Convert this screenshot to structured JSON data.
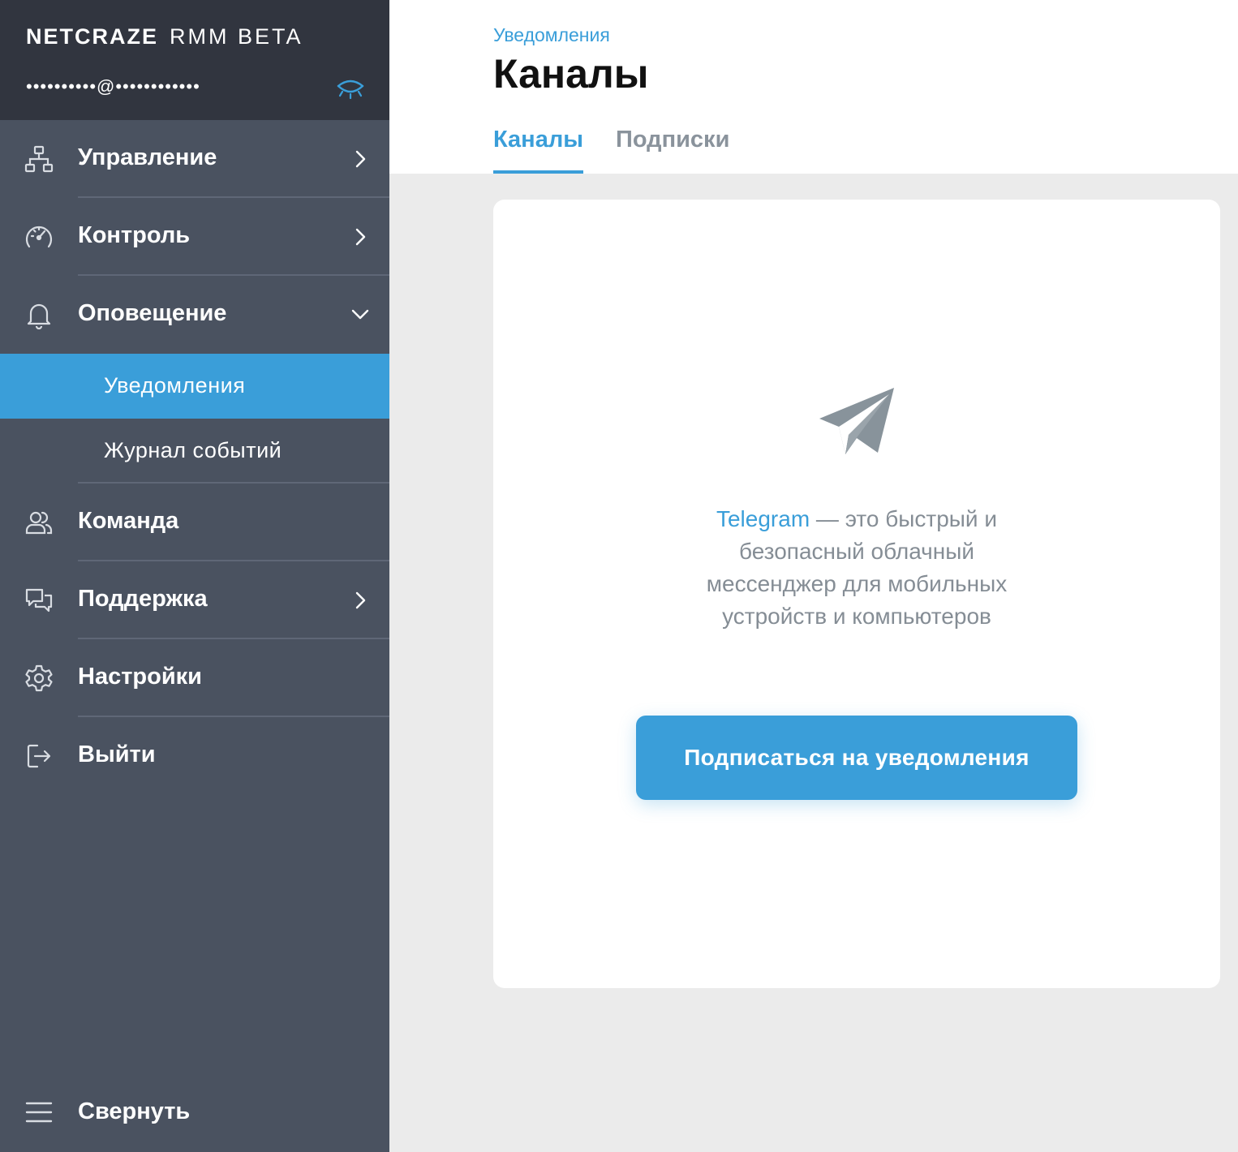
{
  "brand": {
    "name": "NETCRAZE",
    "product": "RMM BETA"
  },
  "account": {
    "masked_email": "••••••••••@••••••••••••"
  },
  "nav": {
    "items": [
      {
        "label": "Управление",
        "icon": "hierarchy-icon",
        "expandable": true
      },
      {
        "label": "Контроль",
        "icon": "speedometer-icon",
        "expandable": true
      },
      {
        "label": "Оповещение",
        "icon": "bell-icon",
        "expandable": true,
        "expanded": true
      }
    ],
    "sub_items": [
      {
        "label": "Уведомления",
        "active": true
      },
      {
        "label": "Журнал событий"
      }
    ],
    "items_after": [
      {
        "label": "Команда",
        "icon": "team-icon"
      },
      {
        "label": "Поддержка",
        "icon": "chat-icon",
        "expandable": true
      },
      {
        "label": "Настройки",
        "icon": "gear-icon"
      },
      {
        "label": "Выйти",
        "icon": "logout-icon"
      }
    ],
    "collapse_label": "Свернуть"
  },
  "header": {
    "breadcrumb": "Уведомления",
    "title": "Каналы",
    "tabs": [
      {
        "label": "Каналы",
        "active": true
      },
      {
        "label": "Подписки"
      }
    ]
  },
  "card": {
    "link_text": "Telegram",
    "description": " — это быстрый и безопасный облачный мессенджер для мобильных устройств и компьютеров",
    "button_label": "Подписаться на уведомления"
  },
  "colors": {
    "accent": "#3a9ed9",
    "sidebar": "#4a5260",
    "sidebar_header": "#31353f"
  }
}
